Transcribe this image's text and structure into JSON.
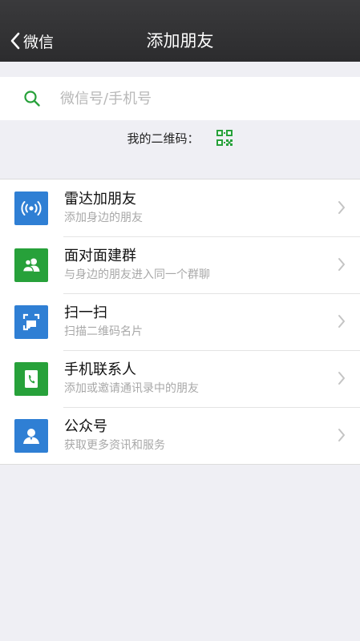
{
  "navbar": {
    "back_label": "微信",
    "title": "添加朋友"
  },
  "search": {
    "placeholder": "微信号/手机号"
  },
  "qr": {
    "label": "我的二维码："
  },
  "items": [
    {
      "title": "雷达加朋友",
      "subtitle": "添加身边的朋友",
      "icon": "radar-icon",
      "color": "#2f7fd4"
    },
    {
      "title": "面对面建群",
      "subtitle": "与身边的朋友进入同一个群聊",
      "icon": "group-icon",
      "color": "#27a13a"
    },
    {
      "title": "扫一扫",
      "subtitle": "扫描二维码名片",
      "icon": "scan-icon",
      "color": "#2f7fd4"
    },
    {
      "title": "手机联系人",
      "subtitle": "添加或邀请通讯录中的朋友",
      "icon": "phone-contacts-icon",
      "color": "#27a13a"
    },
    {
      "title": "公众号",
      "subtitle": "获取更多资讯和服务",
      "icon": "official-account-icon",
      "color": "#2f7fd4"
    }
  ]
}
